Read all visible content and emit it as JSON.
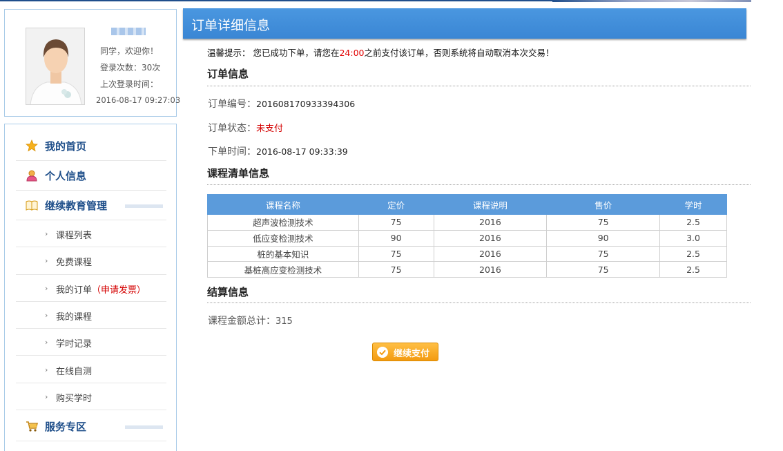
{
  "profile": {
    "greeting": "同学，欢迎你！",
    "login_count": "登录次数：30次",
    "last_login_label": "上次登录时间：",
    "last_login_time": "2016-08-17 09:27:03"
  },
  "nav": {
    "home": "我的首页",
    "personal": "个人信息",
    "education": "继续教育管理",
    "course_list": "课程列表",
    "free_courses": "免费课程",
    "my_orders": "我的订单",
    "apply_invoice": "（申请发票）",
    "my_courses": "我的课程",
    "study_records": "学时记录",
    "online_test": "在线自测",
    "buy_hours": "购买学时",
    "service": "服务专区"
  },
  "header": {
    "title": "订单详细信息"
  },
  "notice": {
    "prefix": "温馨提示：  您已成功下单，请您在",
    "time": "24:00",
    "suffix": "之前支付该订单，否则系统将自动取消本次交易！"
  },
  "order": {
    "section": "订单信息",
    "number_label": "订单编号：",
    "number": "201608170933394306",
    "status_label": "订单状态：",
    "status": "未支付",
    "time_label": "下单时间：",
    "time": "2016-08-17 09:33:39"
  },
  "courses": {
    "section": "课程清单信息",
    "headers": [
      "课程名称",
      "定价",
      "课程说明",
      "售价",
      "学时"
    ],
    "rows": [
      [
        "超声波检测技术",
        "75",
        "2016",
        "75",
        "2.5"
      ],
      [
        "低应变检测技术",
        "90",
        "2016",
        "90",
        "3.0"
      ],
      [
        "桩的基本知识",
        "75",
        "2016",
        "75",
        "2.5"
      ],
      [
        "基桩高应变检测技术",
        "75",
        "2016",
        "75",
        "2.5"
      ]
    ]
  },
  "settlement": {
    "section": "结算信息",
    "total_label": "课程金额总计：",
    "total": "315"
  },
  "pay_button": "继续支付",
  "colors": {
    "header_blue": "#3a86d4",
    "nav_blue": "#1f4f8a",
    "accent_red": "#d40000",
    "button_orange": "#f39b11"
  }
}
